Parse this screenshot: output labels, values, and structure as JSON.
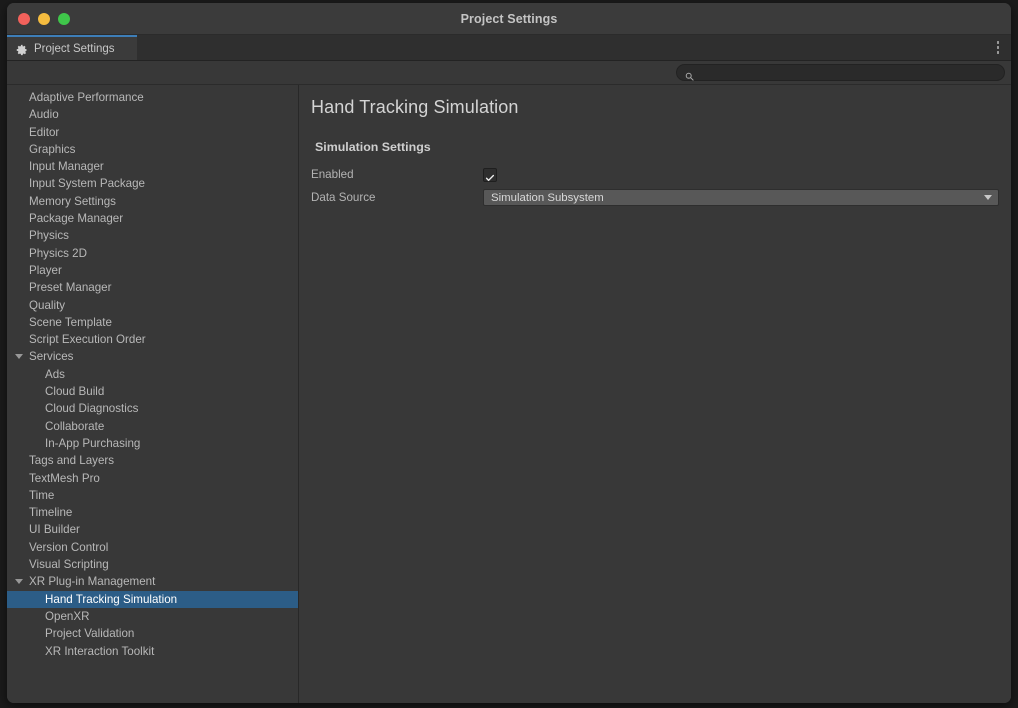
{
  "window": {
    "title": "Project Settings",
    "traffic_lights": [
      {
        "name": "close-button",
        "color": "#f2615b"
      },
      {
        "name": "minimize-button",
        "color": "#f5bc3f"
      },
      {
        "name": "maximize-button",
        "color": "#3fc64a"
      }
    ]
  },
  "tabbar": {
    "tab_label": "Project Settings",
    "tab_icon": "gear-icon",
    "overflow_menu": "kebab-menu-icon",
    "accent_color": "#3d7eb8"
  },
  "search": {
    "value": "",
    "placeholder": "",
    "icon": "search-icon"
  },
  "sidebar": {
    "items": [
      {
        "label": "Adaptive Performance",
        "depth": 0,
        "expandable": false,
        "selected": false
      },
      {
        "label": "Audio",
        "depth": 0,
        "expandable": false,
        "selected": false
      },
      {
        "label": "Editor",
        "depth": 0,
        "expandable": false,
        "selected": false
      },
      {
        "label": "Graphics",
        "depth": 0,
        "expandable": false,
        "selected": false
      },
      {
        "label": "Input Manager",
        "depth": 0,
        "expandable": false,
        "selected": false
      },
      {
        "label": "Input System Package",
        "depth": 0,
        "expandable": false,
        "selected": false
      },
      {
        "label": "Memory Settings",
        "depth": 0,
        "expandable": false,
        "selected": false
      },
      {
        "label": "Package Manager",
        "depth": 0,
        "expandable": false,
        "selected": false
      },
      {
        "label": "Physics",
        "depth": 0,
        "expandable": false,
        "selected": false
      },
      {
        "label": "Physics 2D",
        "depth": 0,
        "expandable": false,
        "selected": false
      },
      {
        "label": "Player",
        "depth": 0,
        "expandable": false,
        "selected": false
      },
      {
        "label": "Preset Manager",
        "depth": 0,
        "expandable": false,
        "selected": false
      },
      {
        "label": "Quality",
        "depth": 0,
        "expandable": false,
        "selected": false
      },
      {
        "label": "Scene Template",
        "depth": 0,
        "expandable": false,
        "selected": false
      },
      {
        "label": "Script Execution Order",
        "depth": 0,
        "expandable": false,
        "selected": false
      },
      {
        "label": "Services",
        "depth": 0,
        "expandable": true,
        "expanded": true,
        "selected": false
      },
      {
        "label": "Ads",
        "depth": 1,
        "expandable": false,
        "selected": false
      },
      {
        "label": "Cloud Build",
        "depth": 1,
        "expandable": false,
        "selected": false
      },
      {
        "label": "Cloud Diagnostics",
        "depth": 1,
        "expandable": false,
        "selected": false
      },
      {
        "label": "Collaborate",
        "depth": 1,
        "expandable": false,
        "selected": false
      },
      {
        "label": "In-App Purchasing",
        "depth": 1,
        "expandable": false,
        "selected": false
      },
      {
        "label": "Tags and Layers",
        "depth": 0,
        "expandable": false,
        "selected": false
      },
      {
        "label": "TextMesh Pro",
        "depth": 0,
        "expandable": false,
        "selected": false
      },
      {
        "label": "Time",
        "depth": 0,
        "expandable": false,
        "selected": false
      },
      {
        "label": "Timeline",
        "depth": 0,
        "expandable": false,
        "selected": false
      },
      {
        "label": "UI Builder",
        "depth": 0,
        "expandable": false,
        "selected": false
      },
      {
        "label": "Version Control",
        "depth": 0,
        "expandable": false,
        "selected": false
      },
      {
        "label": "Visual Scripting",
        "depth": 0,
        "expandable": false,
        "selected": false
      },
      {
        "label": "XR Plug-in Management",
        "depth": 0,
        "expandable": true,
        "expanded": true,
        "selected": false
      },
      {
        "label": "Hand Tracking Simulation",
        "depth": 1,
        "expandable": false,
        "selected": true
      },
      {
        "label": "OpenXR",
        "depth": 1,
        "expandable": false,
        "selected": false
      },
      {
        "label": "Project Validation",
        "depth": 1,
        "expandable": false,
        "selected": false
      },
      {
        "label": "XR Interaction Toolkit",
        "depth": 1,
        "expandable": false,
        "selected": false
      }
    ],
    "selection_color": "#2c5d87"
  },
  "content": {
    "page_title": "Hand Tracking Simulation",
    "section_title": "Simulation Settings",
    "fields": {
      "enabled": {
        "label": "Enabled",
        "type": "checkbox",
        "checked": true
      },
      "data_source": {
        "label": "Data Source",
        "type": "dropdown",
        "value": "Simulation Subsystem",
        "caret": "chevron-down-icon"
      }
    }
  }
}
